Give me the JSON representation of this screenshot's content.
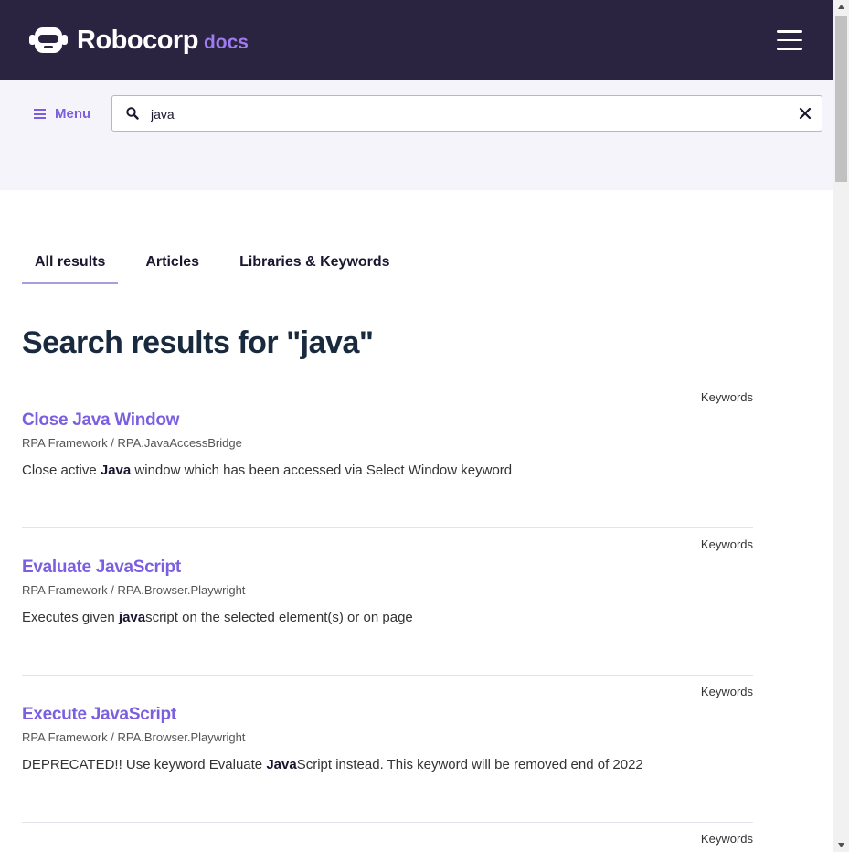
{
  "navbar": {
    "brand": "Robocorp",
    "brand_suffix": "docs",
    "logo_icon": "robot-head-icon",
    "menu_icon": "hamburger-icon"
  },
  "search": {
    "menu_label": "Menu",
    "value": "java",
    "search_icon": "search-icon",
    "clear_icon": "close-icon"
  },
  "tabs": [
    {
      "label": "All results",
      "active": true
    },
    {
      "label": "Articles",
      "active": false
    },
    {
      "label": "Libraries & Keywords",
      "active": false
    }
  ],
  "page_title": "Search results for \"java\"",
  "results": [
    {
      "type": "Keywords",
      "title": "Close Java Window",
      "path": "RPA Framework / RPA.JavaAccessBridge",
      "desc_before": "Close active ",
      "desc_bold": "Java",
      "desc_after": " window which has been accessed via Select Window keyword"
    },
    {
      "type": "Keywords",
      "title": "Evaluate JavaScript",
      "path": "RPA Framework / RPA.Browser.Playwright",
      "desc_before": "Executes given ",
      "desc_bold": "java",
      "desc_after": "script on the selected element(s) or on page"
    },
    {
      "type": "Keywords",
      "title": "Execute JavaScript",
      "path": "RPA Framework / RPA.Browser.Playwright",
      "desc_before": "DEPRECATED!! Use keyword Evaluate ",
      "desc_bold": "Java",
      "desc_after": "Script instead. This keyword will be removed end of 2022"
    },
    {
      "type": "Keywords"
    }
  ],
  "colors": {
    "navbar_bg": "#2a2440",
    "accent": "#7b5fe0",
    "band_bg": "#f5f4fa",
    "title": "#1a2a3e"
  }
}
